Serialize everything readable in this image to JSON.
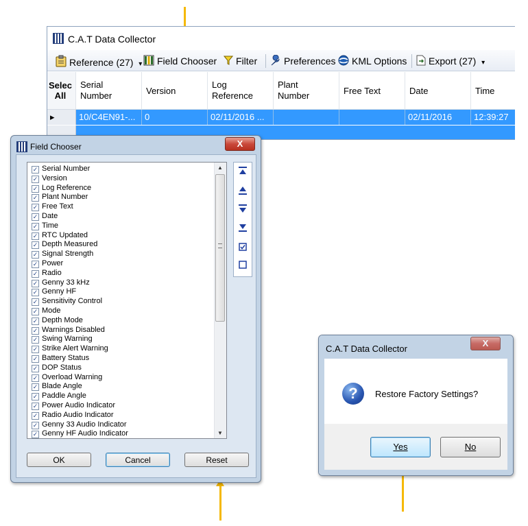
{
  "main_window": {
    "title": "C.A.T Data Collector",
    "toolbar": {
      "reference": "Reference (27)",
      "field_chooser": "Field Chooser",
      "filter": "Filter",
      "preferences": "Preferences",
      "kml_options": "KML Options",
      "export": "Export (27)",
      "dropdown_glyph": "▾"
    },
    "grid": {
      "select_all_line1": "Selec",
      "select_all_line2": "All",
      "columns": [
        "Serial\nNumber",
        "Version",
        "Log\nReference",
        "Plant\nNumber",
        "Free Text",
        "Date",
        "Time"
      ],
      "rows": [
        {
          "serial": "10/C4EN91-...",
          "version": "0",
          "log_reference": "02/11/2016 ...",
          "plant": "",
          "free_text": "",
          "date": "02/11/2016",
          "time": "12:39:27"
        }
      ]
    }
  },
  "field_chooser": {
    "title": "Field Chooser",
    "close_glyph": "X",
    "items": [
      "Serial Number",
      "Version",
      "Log Reference",
      "Plant Number",
      "Free Text",
      "Date",
      "Time",
      "RTC Updated",
      "Depth Measured",
      "Signal Strength",
      "Power",
      "Radio",
      "Genny 33 kHz",
      "Genny HF",
      "Sensitivity Control",
      "Mode",
      "Depth Mode",
      "Warnings Disabled",
      "Swing Warning",
      "Strike Alert Warning",
      "Battery Status",
      "DOP Status",
      "Overload Warning",
      "Blade Angle",
      "Paddle Angle",
      "Power Audio Indicator",
      "Radio Audio Indicator",
      "Genny 33 Audio Indicator",
      "Genny HF Audio Indicator"
    ],
    "checked_glyph": "✓",
    "ok": "OK",
    "cancel": "Cancel",
    "reset": "Reset"
  },
  "restore_dialog": {
    "title": "C.A.T Data Collector",
    "close_glyph": "X",
    "message": "Restore Factory Settings?",
    "yes": "Yes",
    "no": "No"
  },
  "colors": {
    "annotation_arrow": "#f5b800",
    "selected_row": "#3399ff",
    "dialog_frame": "#c2d3e5"
  }
}
